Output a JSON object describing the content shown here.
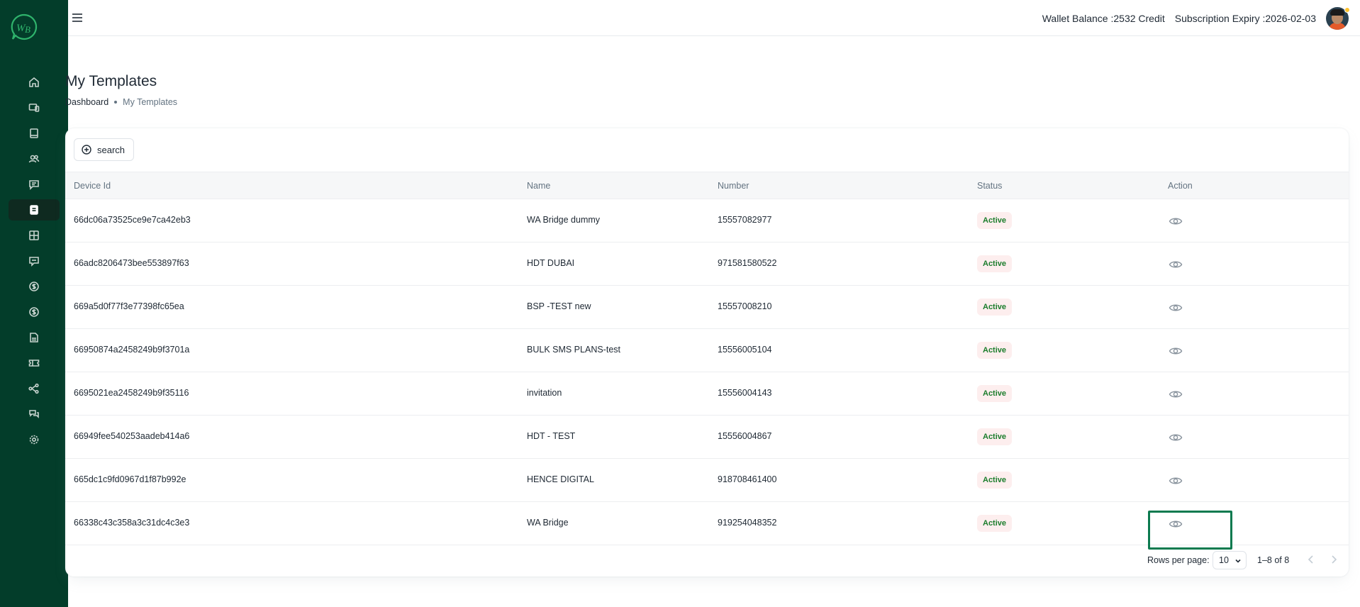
{
  "header": {
    "wallet_label": "Wallet Balance :",
    "wallet_value": "2532 Credit",
    "expiry_label": "Subscription Expiry :",
    "expiry_value": "2026-02-03"
  },
  "sidebar": {
    "brand_mark": "WB",
    "items": [
      {
        "icon": "home-icon"
      },
      {
        "icon": "devices-icon"
      },
      {
        "icon": "book-icon"
      },
      {
        "icon": "contacts-icon"
      },
      {
        "icon": "message-icon"
      },
      {
        "icon": "template-icon",
        "active": true
      },
      {
        "icon": "grid-icon"
      },
      {
        "icon": "chat-icon"
      },
      {
        "icon": "dollar-icon"
      },
      {
        "icon": "dollar-circle-icon"
      },
      {
        "icon": "pdf-icon"
      },
      {
        "icon": "ticket-icon"
      },
      {
        "icon": "flow-icon"
      },
      {
        "icon": "conversation-icon"
      },
      {
        "icon": "settings-icon"
      }
    ]
  },
  "page": {
    "title": "My Templates",
    "breadcrumb_home": "Dashboard",
    "breadcrumb_current": "My Templates"
  },
  "toolbar": {
    "search_label": "search"
  },
  "table": {
    "columns": [
      "Device Id",
      "Name",
      "Number",
      "Status",
      "Action"
    ],
    "rows": [
      {
        "device_id": "66dc06a73525ce9e7ca42eb3",
        "name": "WA Bridge dummy",
        "number": "15557082977",
        "status": "Active"
      },
      {
        "device_id": "66adc8206473bee553897f63",
        "name": "HDT DUBAI",
        "number": "971581580522",
        "status": "Active"
      },
      {
        "device_id": "669a5d0f77f3e77398fc65ea",
        "name": "BSP -TEST new",
        "number": "15557008210",
        "status": "Active"
      },
      {
        "device_id": "66950874a2458249b9f3701a",
        "name": "BULK SMS PLANS-test",
        "number": "15556005104",
        "status": "Active"
      },
      {
        "device_id": "6695021ea2458249b9f35116",
        "name": "invitation",
        "number": "15556004143",
        "status": "Active"
      },
      {
        "device_id": "66949fee540253aadeb414a6",
        "name": "HDT - TEST",
        "number": "15556004867",
        "status": "Active"
      },
      {
        "device_id": "665dc1c9fd0967d1f87b992e",
        "name": "HENCE DIGITAL",
        "number": "918708461400",
        "status": "Active"
      },
      {
        "device_id": "66338c43c358a3c31dc4c3e3",
        "name": "WA Bridge",
        "number": "919254048352",
        "status": "Active"
      }
    ]
  },
  "pagination": {
    "rows_per_page_label": "Rows per page:",
    "rows_per_page_value": "10",
    "range": "1–8 of 8"
  },
  "colors": {
    "sidebar_bg": "#033d2a",
    "accent": "#0c7a4f",
    "status_text": "#1b7d2c",
    "status_bg": "#fdeeee"
  }
}
